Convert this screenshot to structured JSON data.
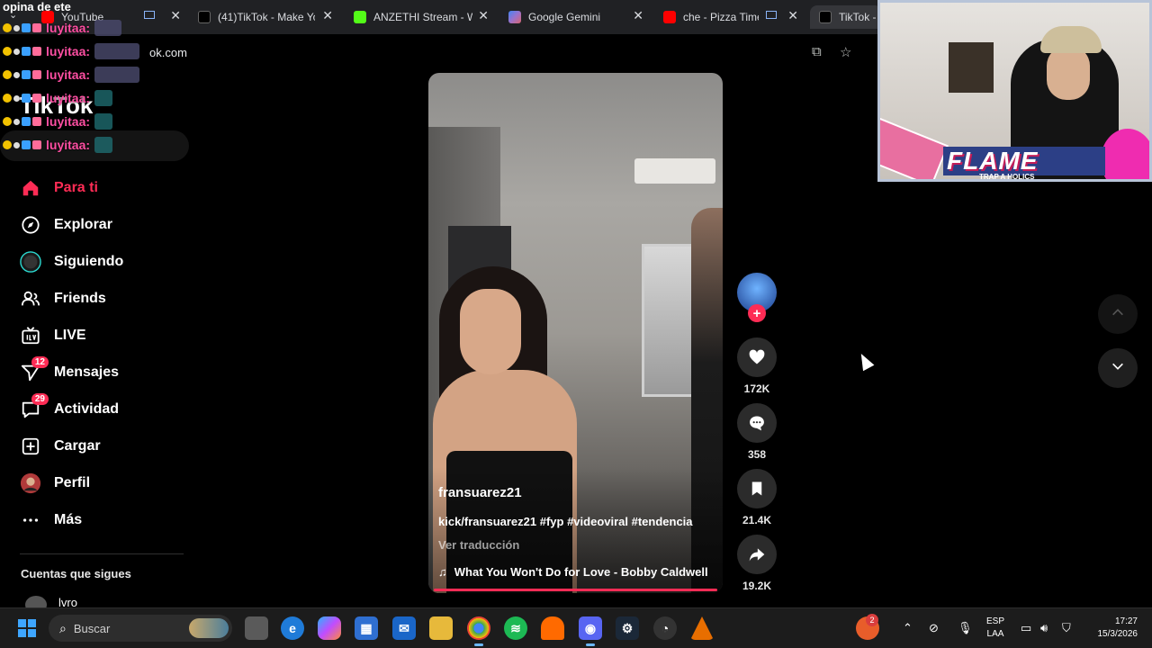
{
  "browser": {
    "tabs": [
      {
        "title": "YouTube"
      },
      {
        "title": "(41)TikTok - Make Yo"
      },
      {
        "title": "ANZETHI Stream - W"
      },
      {
        "title": "Google Gemini"
      },
      {
        "title": "che - Pizza Time"
      },
      {
        "title": "TikTok - "
      }
    ],
    "url": "ok.com"
  },
  "chat": {
    "title": "opina de ete",
    "lines": [
      {
        "user": "luyitaa:"
      },
      {
        "user": "luyitaa:"
      },
      {
        "user": "luyitaa:"
      },
      {
        "user": "luyitaa:"
      },
      {
        "user": "luyitaa:"
      },
      {
        "user": "luyitaa:"
      }
    ]
  },
  "tiktok": {
    "logo": "TikTok",
    "nav": [
      {
        "label": "Para ti"
      },
      {
        "label": "Explorar"
      },
      {
        "label": "Siguiendo"
      },
      {
        "label": "Friends"
      },
      {
        "label": "LIVE"
      },
      {
        "label": "Mensajes",
        "badge": "12"
      },
      {
        "label": "Actividad",
        "badge": "29"
      },
      {
        "label": "Cargar"
      },
      {
        "label": "Perfil"
      },
      {
        "label": "Más"
      }
    ],
    "following_title": "Cuentas que sigues",
    "following_user": "lvro",
    "video": {
      "username": "fransuarez21",
      "description": "kick/fransuarez21 #fyp #videoviral #tendencia",
      "translate": "Ver traducción",
      "music": "What You Won't Do for Love - Bobby Caldwell",
      "music_icon": "♫"
    },
    "actions": {
      "likes": "172K",
      "comments": "358",
      "saves": "21.4K",
      "shares": "19.2K"
    }
  },
  "webcam": {
    "banner": "FLAME",
    "banner_sub": "TRAP A HOLICS"
  },
  "taskbar": {
    "search_placeholder": "Buscar",
    "lang_top": "ESP",
    "lang_bottom": "LAA",
    "time": "17:27",
    "date": "15/3/2026",
    "tray_badge": "2"
  },
  "colors": {
    "accent": "#fe2c55",
    "tab_bg": "#202124"
  }
}
